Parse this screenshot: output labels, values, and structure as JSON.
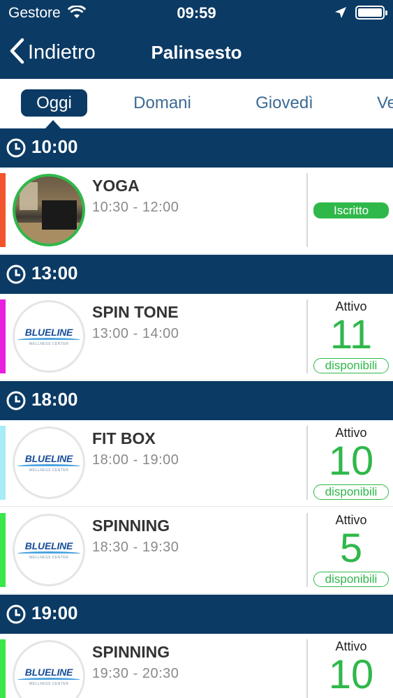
{
  "status_bar": {
    "carrier": "Gestore",
    "time": "09:59"
  },
  "nav": {
    "back_label": "Indietro",
    "title": "Palinsesto"
  },
  "tabs": [
    {
      "label": "Oggi",
      "active": true
    },
    {
      "label": "Domani"
    },
    {
      "label": "Giovedì"
    },
    {
      "label": "Ve"
    }
  ],
  "logo": {
    "word": "BLUELINE",
    "sub": "WELLNESS CENTER"
  },
  "groups": [
    {
      "time": "10:00"
    },
    {
      "time": "13:00"
    },
    {
      "time": "18:00"
    },
    {
      "time": "19:00"
    }
  ],
  "classes": [
    {
      "name": "YOGA",
      "time": "10:30 - 12:00",
      "badge": "Iscritto",
      "bar_color": "#f2542d"
    },
    {
      "name": "SPIN TONE",
      "time": "13:00 - 14:00",
      "state": "Attivo",
      "count": "11",
      "avail_label": "disponibili",
      "bar_color": "#e81fe0"
    },
    {
      "name": "FIT BOX",
      "time": "18:00 - 19:00",
      "state": "Attivo",
      "count": "10",
      "avail_label": "disponibili",
      "bar_color": "#a8ecf7"
    },
    {
      "name": "SPINNING",
      "time": "18:30 - 19:30",
      "state": "Attivo",
      "count": "5",
      "avail_label": "disponibili",
      "bar_color": "#3be64a"
    },
    {
      "name": "SPINNING",
      "time": "19:30 - 20:30",
      "state": "Attivo",
      "count": "10",
      "avail_label": "disponibili",
      "bar_color": "#3be64a"
    }
  ],
  "colors": {
    "header": "#0b3a64",
    "accent_green": "#2fb84a",
    "tab_text": "#3d6a94"
  },
  "icons": {
    "back": "chevron-left-icon",
    "clock": "clock-icon",
    "wifi": "wifi-icon",
    "location": "location-arrow-icon",
    "battery": "battery-icon"
  }
}
